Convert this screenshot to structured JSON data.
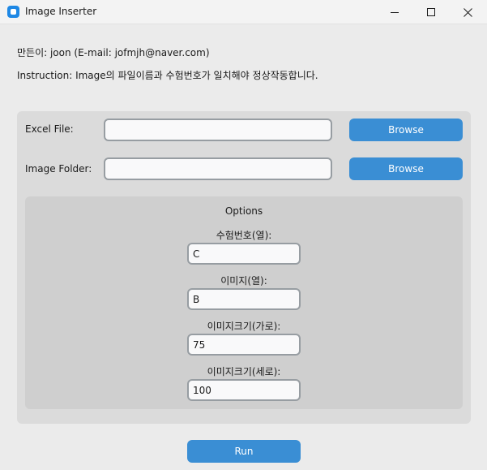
{
  "window": {
    "title": "Image Inserter",
    "icon": "app-icon",
    "controls": [
      "minimize-icon",
      "maximize-icon",
      "close-icon"
    ]
  },
  "header": {
    "author": "만든이: joon (E-mail: jofmjh@naver.com)",
    "instruction": "Instruction: Image의 파일이름과 수험번호가 일치해야 정상작동합니다."
  },
  "files": {
    "excel_label": "Excel File:",
    "excel_value": "",
    "folder_label": "Image Folder:",
    "folder_value": "",
    "browse_label": "Browse"
  },
  "options": {
    "title": "Options",
    "fields": [
      {
        "label": "수험번호(열):",
        "value": "C"
      },
      {
        "label": "이미지(열):",
        "value": "B"
      },
      {
        "label": "이미지크기(가로):",
        "value": "75"
      },
      {
        "label": "이미지크기(세로):",
        "value": "100"
      }
    ]
  },
  "run_label": "Run",
  "colors": {
    "accent": "#3a8ed4",
    "panel": "#dbdbdb",
    "options_panel": "#cfcfcf",
    "background": "#ebebeb"
  }
}
